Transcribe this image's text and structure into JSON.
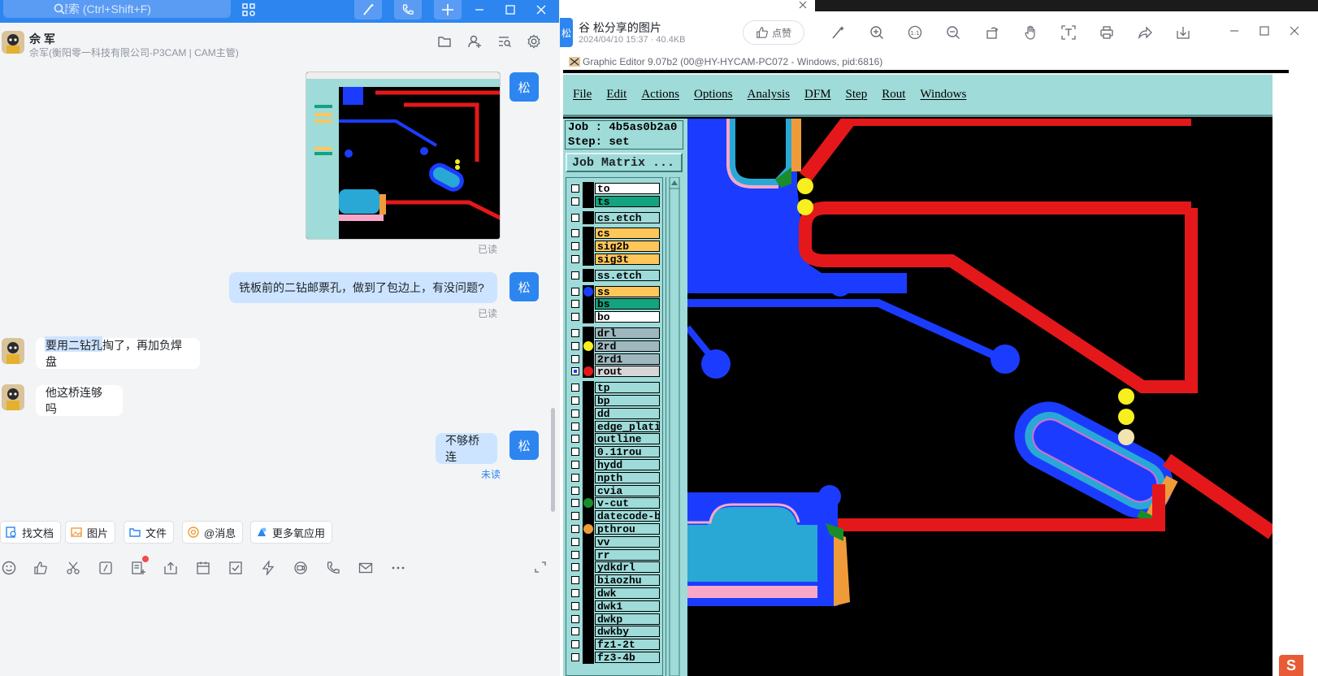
{
  "chat": {
    "search_placeholder": "搜索 (Ctrl+Shift+F)",
    "contact_name": "佘 军",
    "contact_sub": "佘军(衡阳零一科技有限公司-P3CAM | CAM主管)",
    "my_avatar_text": "松",
    "messages": [
      {
        "side": "me",
        "type": "image",
        "status": "已读"
      },
      {
        "side": "me",
        "type": "text",
        "text": "铣板前的二钻邮票孔，做到了包边上，有没问题?",
        "status": "已读"
      },
      {
        "side": "other",
        "type": "text",
        "text": "要用二钻孔掏了，再加负焊盘"
      },
      {
        "side": "other",
        "type": "text",
        "text": "他这桥连够吗"
      },
      {
        "side": "me",
        "type": "text",
        "text": "不够桥连",
        "status": "未读"
      }
    ],
    "quick_buttons": [
      "找文档",
      "图片",
      "文件",
      "@消息",
      "更多氧应用"
    ]
  },
  "viewer": {
    "title": "谷  松分享的图片",
    "meta": "2024/04/10 15:37 · 40.4KB",
    "like_label": "点赞"
  },
  "editor": {
    "title": "Graphic Editor 9.07b2 (00@HY-HYCAM-PC072 - Windows, pid:6816)",
    "menu": [
      "File",
      "Edit",
      "Actions",
      "Options",
      "Analysis",
      "DFM",
      "Step",
      "Rout",
      "Windows"
    ],
    "job_line": "Job : 4b5as0b2a0",
    "step_line": "Step: set",
    "job_matrix": "Job Matrix ...",
    "layers": [
      {
        "name": "to",
        "bg": "#ffffff",
        "dot": ""
      },
      {
        "name": "ts",
        "bg": "#14a37f",
        "dot": ""
      },
      {
        "name": "cs.etch",
        "bg": "#9edbd9",
        "dot": ""
      },
      {
        "name": "cs",
        "bg": "#ffc65a",
        "dot": ""
      },
      {
        "name": "sig2b",
        "bg": "#ffc65a",
        "dot": ""
      },
      {
        "name": "sig3t",
        "bg": "#ffc65a",
        "dot": ""
      },
      {
        "name": "ss.etch",
        "bg": "#9edbd9",
        "dot": ""
      },
      {
        "name": "ss",
        "bg": "#ffc65a",
        "dot": "#1b3cff"
      },
      {
        "name": "bs",
        "bg": "#14a37f",
        "dot": ""
      },
      {
        "name": "bo",
        "bg": "#ffffff",
        "dot": ""
      },
      {
        "name": "drl",
        "bg": "#9fb8bf",
        "dot": ""
      },
      {
        "name": "2rd",
        "bg": "#9fb8bf",
        "dot": "#f7ef1e"
      },
      {
        "name": "2rd1",
        "bg": "#9fb8bf",
        "dot": ""
      },
      {
        "name": "rout",
        "bg": "#d6d6d6",
        "dot": "#e4181a"
      },
      {
        "name": "tp",
        "bg": "#9edbd9",
        "dot": ""
      },
      {
        "name": "bp",
        "bg": "#9edbd9",
        "dot": ""
      },
      {
        "name": "dd",
        "bg": "#9edbd9",
        "dot": ""
      },
      {
        "name": "edge_plating",
        "bg": "#9edbd9",
        "dot": ""
      },
      {
        "name": "outline",
        "bg": "#9edbd9",
        "dot": ""
      },
      {
        "name": "0.11rou",
        "bg": "#9edbd9",
        "dot": ""
      },
      {
        "name": "hydd",
        "bg": "#9edbd9",
        "dot": ""
      },
      {
        "name": "npth",
        "bg": "#9edbd9",
        "dot": ""
      },
      {
        "name": "cvia",
        "bg": "#9edbd9",
        "dot": ""
      },
      {
        "name": "v-cut",
        "bg": "#9edbd9",
        "dot": "#1a8c2a"
      },
      {
        "name": "datecode-bo",
        "bg": "#9edbd9",
        "dot": ""
      },
      {
        "name": "pthrou",
        "bg": "#9edbd9",
        "dot": "#f09b3a"
      },
      {
        "name": "vv",
        "bg": "#9edbd9",
        "dot": ""
      },
      {
        "name": "rr",
        "bg": "#9edbd9",
        "dot": ""
      },
      {
        "name": "ydkdrl",
        "bg": "#9edbd9",
        "dot": ""
      },
      {
        "name": "biaozhu",
        "bg": "#9edbd9",
        "dot": ""
      },
      {
        "name": "dwk",
        "bg": "#9edbd9",
        "dot": ""
      },
      {
        "name": "dwk1",
        "bg": "#9edbd9",
        "dot": ""
      },
      {
        "name": "dwkp",
        "bg": "#9edbd9",
        "dot": ""
      },
      {
        "name": "dwkby",
        "bg": "#9edbd9",
        "dot": ""
      },
      {
        "name": "fz1-2t",
        "bg": "#9edbd9",
        "dot": ""
      },
      {
        "name": "fz3-4b",
        "bg": "#9edbd9",
        "dot": ""
      }
    ]
  },
  "colors": {
    "accent": "#2d86f0",
    "bubble_me": "#cce4ff",
    "editor_panel": "#9edbd9"
  }
}
